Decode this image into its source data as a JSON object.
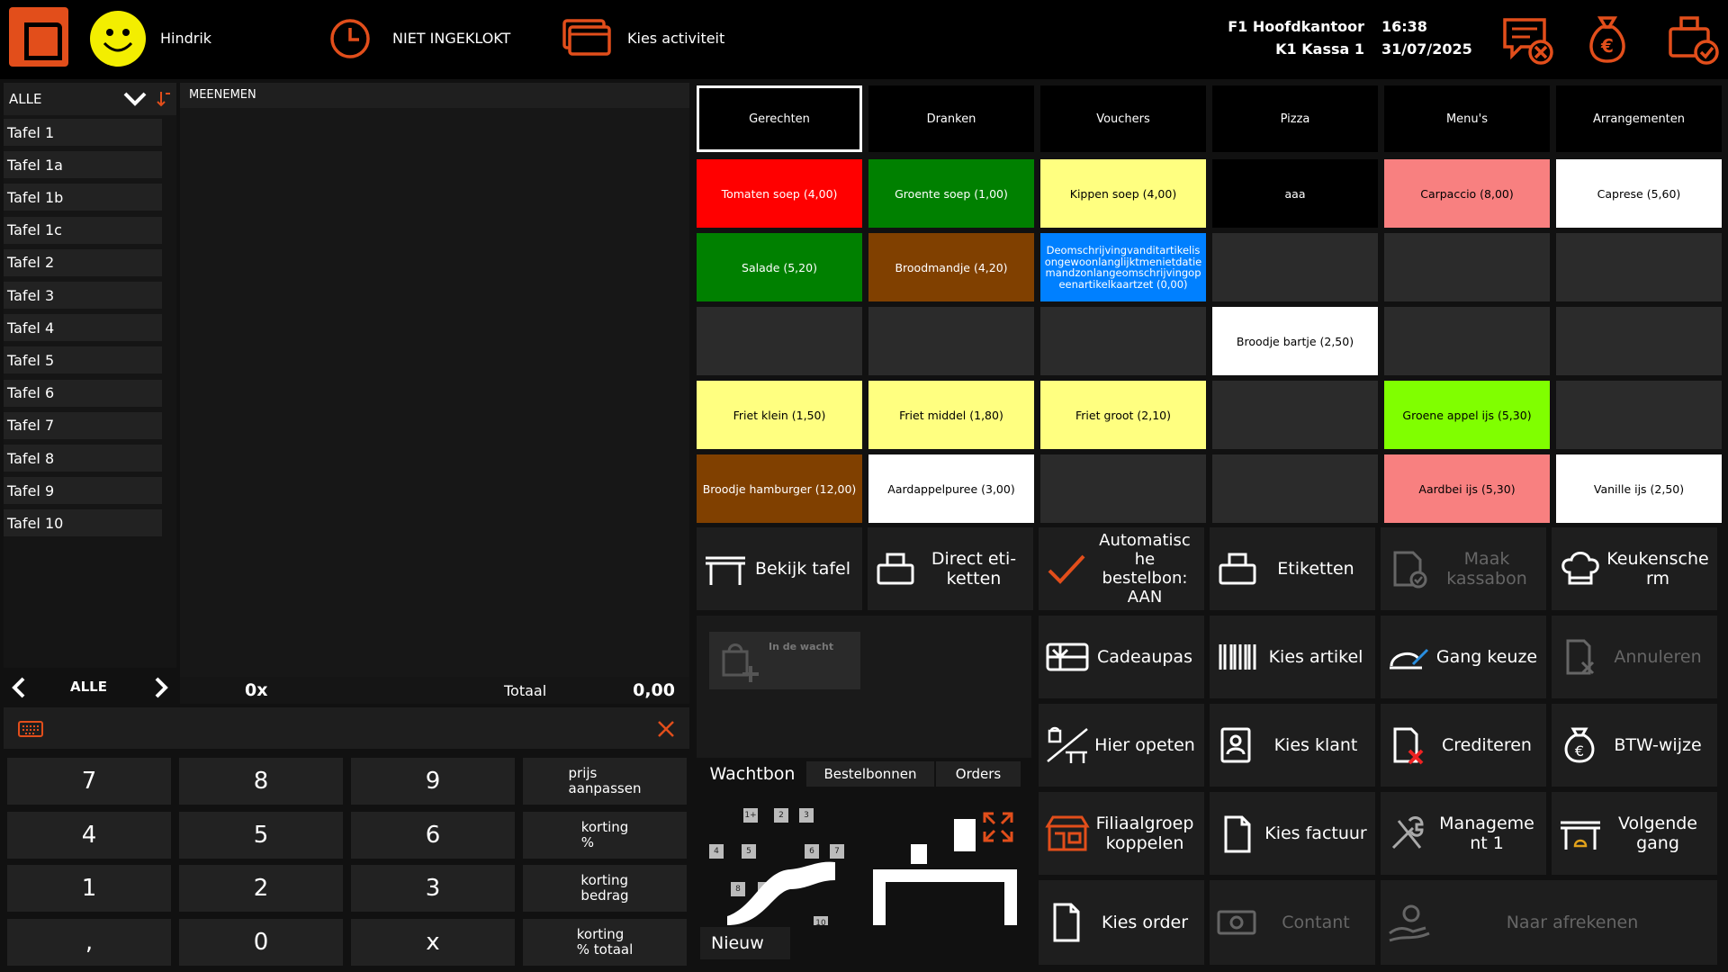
{
  "header": {
    "user_name": "Hindrik",
    "clock_status": "NIET INGEKLOKT",
    "activity": "Kies activiteit",
    "branch": "F1 Hoofdkantoor",
    "register": "K1 Kassa 1",
    "time": "16:38",
    "date": "31/07/2025"
  },
  "tables": {
    "filter": "ALLE",
    "items": [
      "Tafel 1",
      "Tafel 1a",
      "Tafel 1b",
      "Tafel 1c",
      "Tafel 2",
      "Tafel 3",
      "Tafel 4",
      "Tafel 5",
      "Tafel 6",
      "Tafel 7",
      "Tafel 8",
      "Tafel 9",
      "Tafel 10"
    ],
    "pager_label": "ALLE"
  },
  "order": {
    "title": "MEENEMEN",
    "count": "0x",
    "total_label": "Totaal",
    "total": "0,00"
  },
  "keypad": {
    "row1": [
      "7",
      "8",
      "9",
      "prijs\naanpassen"
    ],
    "row2": [
      "4",
      "5",
      "6",
      "korting\n%"
    ],
    "row3": [
      "1",
      "2",
      "3",
      "korting\nbedrag"
    ],
    "row4": [
      ",",
      "0",
      "x",
      "korting\n% totaal"
    ]
  },
  "categories": [
    "Gerechten",
    "Dranken",
    "Vouchers",
    "Pizza",
    "Menu's",
    "Arrangementen"
  ],
  "articles": [
    [
      {
        "label": "Tomaten soep (4,00)",
        "bg": "#ff0000",
        "fg": "#ffffff"
      },
      {
        "label": "Groente soep (1,00)",
        "bg": "#008000",
        "fg": "#ffffff"
      },
      {
        "label": "Kippen soep (4,00)",
        "bg": "#ffff80",
        "fg": "#000000"
      },
      {
        "label": "aaa",
        "bg": "#000000",
        "fg": "#ffffff"
      },
      {
        "label": "Carpaccio (8,00)",
        "bg": "#f88080",
        "fg": "#000000"
      },
      {
        "label": "Caprese (5,60)",
        "bg": "#ffffff",
        "fg": "#000000"
      }
    ],
    [
      {
        "label": "Salade (5,20)",
        "bg": "#008000",
        "fg": "#ffffff"
      },
      {
        "label": "Broodmandje (4,20)",
        "bg": "#804000",
        "fg": "#ffffff"
      },
      {
        "label": "Deomschrijvingvanditartikelisongewoonlanglijktmenietdatiemandzonlangeomschrijvingopeenartikelkaartzet (0,00)",
        "bg": "#0080ff",
        "fg": "#ffffff"
      },
      {
        "label": "",
        "bg": "#2b2b2b",
        "fg": "#ffffff"
      },
      {
        "label": "",
        "bg": "#2b2b2b",
        "fg": "#ffffff"
      },
      {
        "label": "",
        "bg": "#2b2b2b",
        "fg": "#ffffff"
      }
    ],
    [
      {
        "label": "",
        "bg": "#2b2b2b",
        "fg": "#ffffff"
      },
      {
        "label": "",
        "bg": "#2b2b2b",
        "fg": "#ffffff"
      },
      {
        "label": "",
        "bg": "#2b2b2b",
        "fg": "#ffffff"
      },
      {
        "label": "Broodje bartje (2,50)",
        "bg": "#ffffff",
        "fg": "#000000"
      },
      {
        "label": "",
        "bg": "#2b2b2b",
        "fg": "#ffffff"
      },
      {
        "label": "",
        "bg": "#2b2b2b",
        "fg": "#ffffff"
      }
    ],
    [
      {
        "label": "Friet klein (1,50)",
        "bg": "#ffff80",
        "fg": "#000000"
      },
      {
        "label": "Friet middel (1,80)",
        "bg": "#ffff80",
        "fg": "#000000"
      },
      {
        "label": "Friet groot (2,10)",
        "bg": "#ffff80",
        "fg": "#000000"
      },
      {
        "label": "",
        "bg": "#2b2b2b",
        "fg": "#ffffff"
      },
      {
        "label": "Groene appel ijs (5,30)",
        "bg": "#80ff00",
        "fg": "#000000"
      },
      {
        "label": "",
        "bg": "#2b2b2b",
        "fg": "#ffffff"
      }
    ],
    [
      {
        "label": "Broodje hamburger (12,00)",
        "bg": "#804000",
        "fg": "#ffffff"
      },
      {
        "label": "Aardappelpuree (3,00)",
        "bg": "#ffffff",
        "fg": "#000000"
      },
      {
        "label": "",
        "bg": "#2b2b2b",
        "fg": "#ffffff"
      },
      {
        "label": "",
        "bg": "#2b2b2b",
        "fg": "#ffffff"
      },
      {
        "label": "Aardbei ijs (5,30)",
        "bg": "#f88080",
        "fg": "#000000"
      },
      {
        "label": "Vanille ijs (2,50)",
        "bg": "#ffffff",
        "fg": "#000000"
      }
    ]
  ],
  "actions": {
    "bekijk_tafel": "Bekijk tafel",
    "direct_etiketten": "Direct eti-\nketten",
    "auto_bestelbon": "Automatisc\nhe\nbestelbon:\nAAN",
    "etiketten": "Etiketten",
    "maak_kassabon": "Maak\nkassabon",
    "keukenscherm": "Keukensche\nrm",
    "cadeaupas": "Cadeaupas",
    "kies_artikel": "Kies artikel",
    "gang_keuze": "Gang keuze",
    "annuleren": "Annuleren",
    "hier_opeten": "Hier opeten",
    "kies_klant": "Kies klant",
    "crediteren": "Crediteren",
    "btw_wijze": "BTW-wijze",
    "filiaalgroep": "Filiaalgroep\nkoppelen",
    "kies_factuur": "Kies factuur",
    "management": "Manageme\nnt 1",
    "volgende_gang": "Volgende\ngang",
    "kies_order": "Kies order",
    "contant": "Contant",
    "naar_afrekenen": "Naar afrekenen"
  },
  "waiting": {
    "label": "In de wacht",
    "tabs": [
      "Wachtbon",
      "Bestelbonnen",
      "Orders"
    ],
    "new_label": "Nieuw",
    "map_numbers": [
      "1+",
      "2",
      "3",
      "4",
      "5",
      "6",
      "7",
      "8",
      "9",
      "10"
    ]
  },
  "colors": {
    "accent": "#e24e1b",
    "cell_empty": "#2b2b2b"
  }
}
